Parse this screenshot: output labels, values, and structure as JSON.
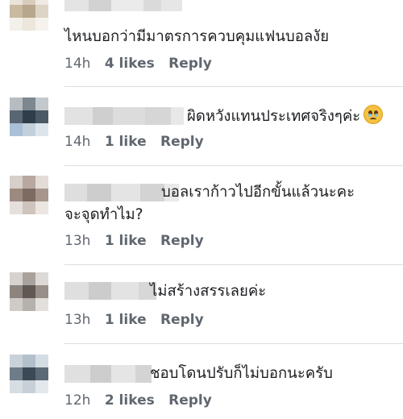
{
  "comments": [
    {
      "text_lines": [
        "ไหนบอกว่ามีมาตรการควบคุมแฟนบอลงัย"
      ],
      "time": "14h",
      "likes": "4 likes",
      "reply": "Reply"
    },
    {
      "text_lines": [
        "ผิดหวังแทนประเทศจริงๆค่ะ"
      ],
      "emoji": "pleading-face-emoji",
      "time": "14h",
      "likes": "1 like",
      "reply": "Reply"
    },
    {
      "text_lines": [
        "บอลเราก้าวไปอีกขั้นแล้วนะคะ",
        "จะจุดทำไม?"
      ],
      "time": "13h",
      "likes": "1 like",
      "reply": "Reply"
    },
    {
      "text_lines": [
        "ไม่สร้างสรรเลยค่ะ"
      ],
      "time": "13h",
      "likes": "1 like",
      "reply": "Reply"
    },
    {
      "text_lines": [
        "ชอบโดนปรับก็ไม่บอกนะครับ"
      ],
      "time": "12h",
      "likes": "2 likes",
      "reply": "Reply"
    }
  ]
}
